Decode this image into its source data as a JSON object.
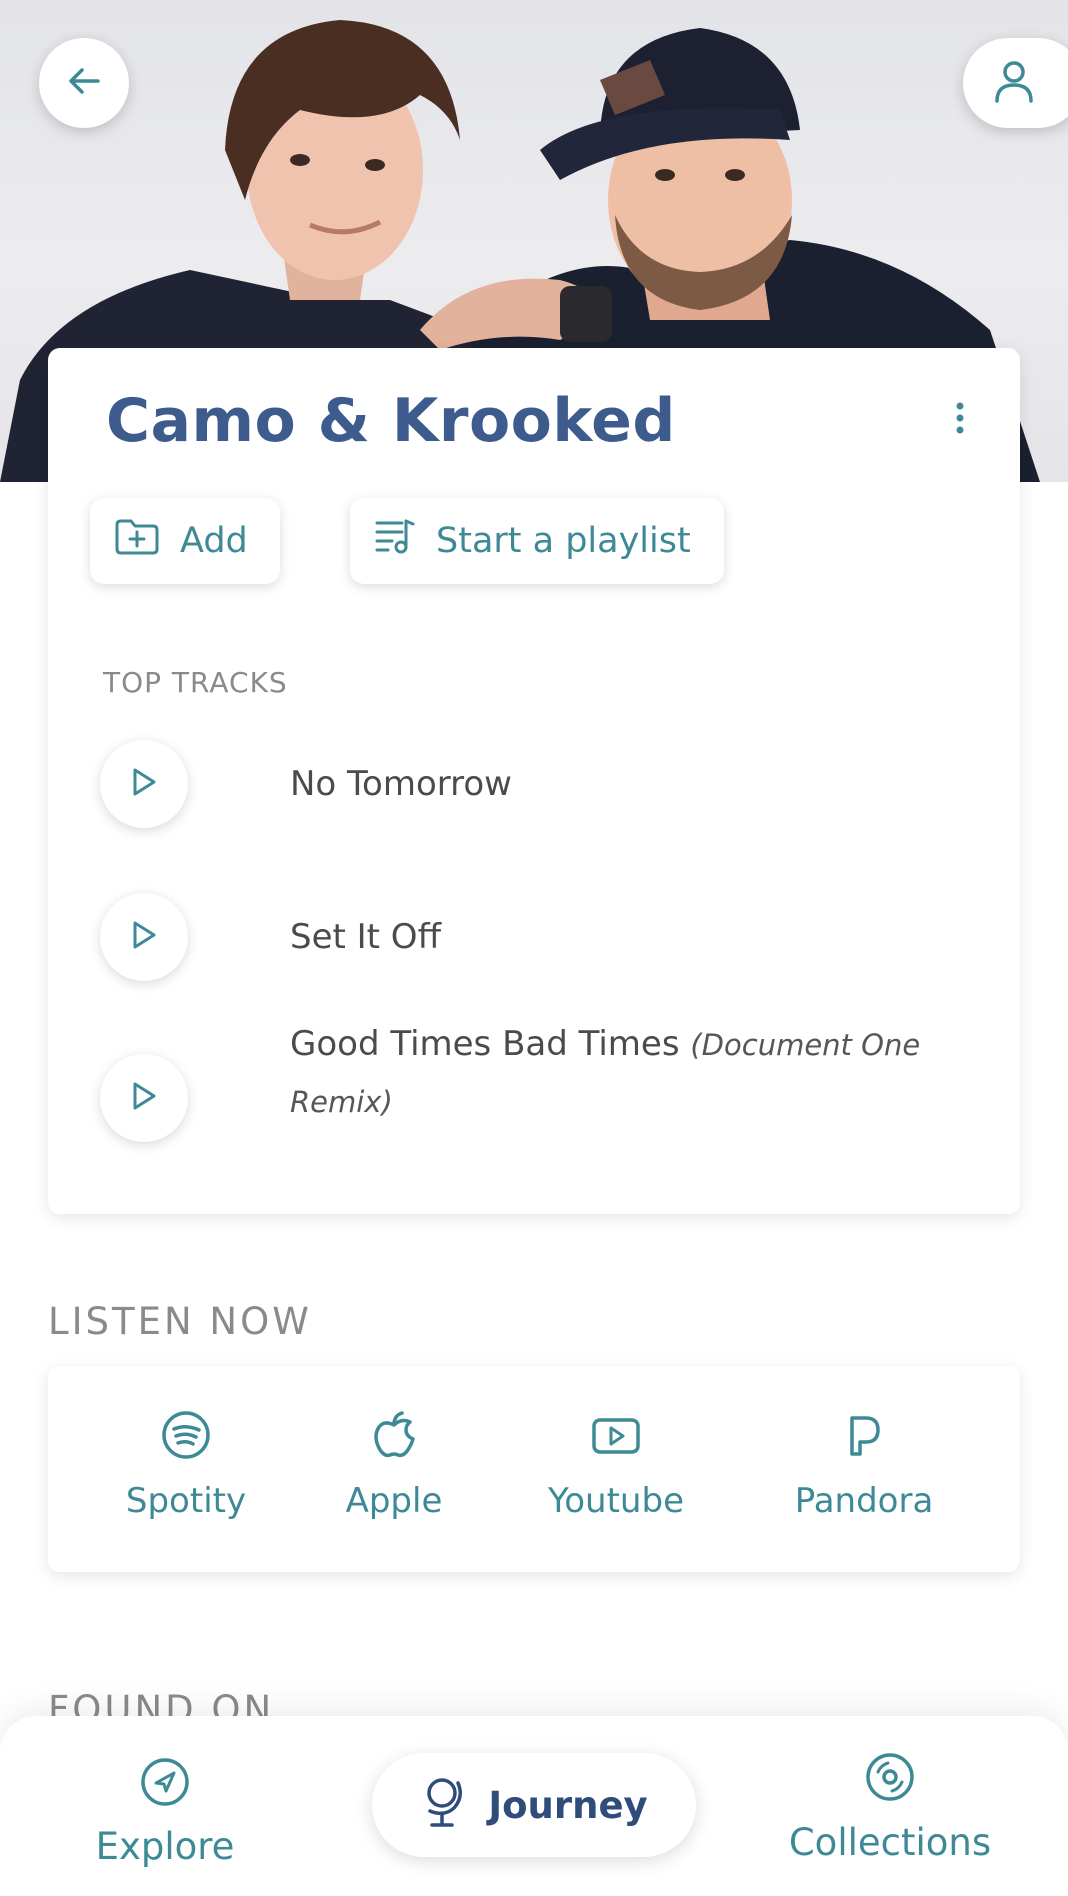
{
  "artist": {
    "name": "Camo & Krooked"
  },
  "actions": {
    "add_label": "Add",
    "playlist_label": "Start a playlist"
  },
  "top_tracks": {
    "heading": "TOP TRACKS",
    "tracks": [
      {
        "title": "No Tomorrow",
        "subtitle": ""
      },
      {
        "title": "Set It Off",
        "subtitle": ""
      },
      {
        "title": "Good Times Bad Times",
        "subtitle": "(Document One Remix)"
      }
    ]
  },
  "listen_now": {
    "heading": "LISTEN NOW",
    "services": [
      {
        "label": "Spotity",
        "icon": "spotify-icon"
      },
      {
        "label": "Apple",
        "icon": "apple-icon"
      },
      {
        "label": "Youtube",
        "icon": "youtube-icon"
      },
      {
        "label": "Pandora",
        "icon": "pandora-icon"
      }
    ]
  },
  "found_on": {
    "heading": "FOUND ON"
  },
  "nav": {
    "explore": "Explore",
    "journey": "Journey",
    "collections": "Collections"
  },
  "colors": {
    "accent_teal": "#3d8a96",
    "title_blue": "#3d5b8c",
    "nav_active": "#2f4c7a"
  }
}
